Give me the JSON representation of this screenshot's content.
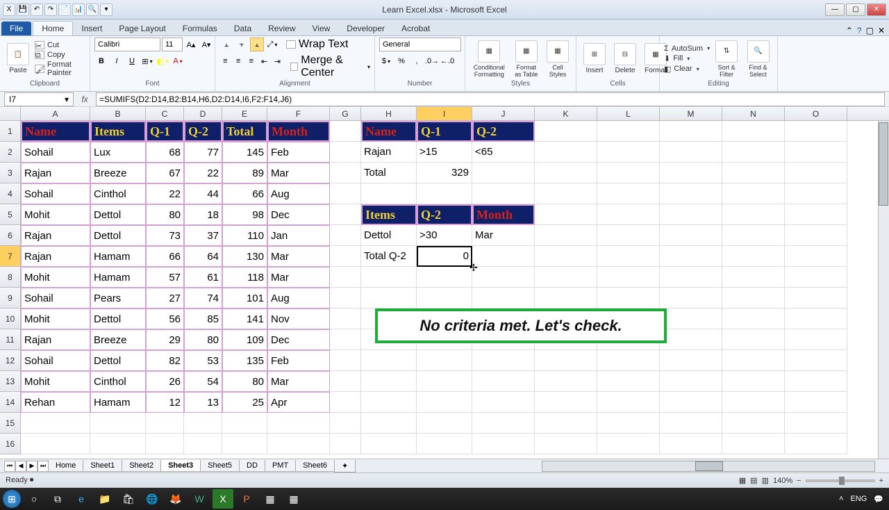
{
  "app": {
    "title": "Learn Excel.xlsx - Microsoft Excel"
  },
  "tabs": {
    "file": "File",
    "home": "Home",
    "insert": "Insert",
    "pagelayout": "Page Layout",
    "formulas": "Formulas",
    "data": "Data",
    "review": "Review",
    "view": "View",
    "developer": "Developer",
    "acrobat": "Acrobat"
  },
  "ribbon": {
    "clipboard": {
      "label": "Clipboard",
      "paste": "Paste",
      "cut": "Cut",
      "copy": "Copy",
      "format_painter": "Format Painter"
    },
    "font": {
      "label": "Font",
      "name": "Calibri",
      "size": "11"
    },
    "alignment": {
      "label": "Alignment",
      "wrap": "Wrap Text",
      "merge": "Merge & Center"
    },
    "number": {
      "label": "Number",
      "format": "General"
    },
    "styles": {
      "label": "Styles",
      "cond": "Conditional Formatting",
      "table": "Format as Table",
      "cell": "Cell Styles"
    },
    "cells": {
      "label": "Cells",
      "insert": "Insert",
      "delete": "Delete",
      "format": "Format"
    },
    "editing": {
      "label": "Editing",
      "autosum": "AutoSum",
      "fill": "Fill",
      "clear": "Clear",
      "sort": "Sort & Filter",
      "find": "Find & Select"
    }
  },
  "namebox": "I7",
  "formula": "=SUMIFS(D2:D14,B2:B14,H6,D2:D14,I6,F2:F14,J6)",
  "cols": [
    "A",
    "B",
    "C",
    "D",
    "E",
    "F",
    "G",
    "H",
    "I",
    "J",
    "K",
    "L",
    "M",
    "N",
    "O"
  ],
  "rows": [
    "1",
    "2",
    "3",
    "4",
    "5",
    "6",
    "7",
    "8",
    "9",
    "10",
    "11",
    "12",
    "13",
    "14",
    "15",
    "16"
  ],
  "headers_main": {
    "name": "Name",
    "items": "Items",
    "q1": "Q-1",
    "q2": "Q-2",
    "total": "Total",
    "month": "Month"
  },
  "table": [
    {
      "name": "Sohail",
      "items": "Lux",
      "q1": "68",
      "q2": "77",
      "total": "145",
      "month": "Feb"
    },
    {
      "name": "Rajan",
      "items": "Breeze",
      "q1": "67",
      "q2": "22",
      "total": "89",
      "month": "Mar"
    },
    {
      "name": "Sohail",
      "items": "Cinthol",
      "q1": "22",
      "q2": "44",
      "total": "66",
      "month": "Aug"
    },
    {
      "name": "Mohit",
      "items": "Dettol",
      "q1": "80",
      "q2": "18",
      "total": "98",
      "month": "Dec"
    },
    {
      "name": "Rajan",
      "items": "Dettol",
      "q1": "73",
      "q2": "37",
      "total": "110",
      "month": "Jan"
    },
    {
      "name": "Rajan",
      "items": "Hamam",
      "q1": "66",
      "q2": "64",
      "total": "130",
      "month": "Mar"
    },
    {
      "name": "Mohit",
      "items": "Hamam",
      "q1": "57",
      "q2": "61",
      "total": "118",
      "month": "Mar"
    },
    {
      "name": "Sohail",
      "items": "Pears",
      "q1": "27",
      "q2": "74",
      "total": "101",
      "month": "Aug"
    },
    {
      "name": "Mohit",
      "items": "Dettol",
      "q1": "56",
      "q2": "85",
      "total": "141",
      "month": "Nov"
    },
    {
      "name": "Rajan",
      "items": "Breeze",
      "q1": "29",
      "q2": "80",
      "total": "109",
      "month": "Dec"
    },
    {
      "name": "Sohail",
      "items": "Dettol",
      "q1": "82",
      "q2": "53",
      "total": "135",
      "month": "Feb"
    },
    {
      "name": "Mohit",
      "items": "Cinthol",
      "q1": "26",
      "q2": "54",
      "total": "80",
      "month": "Mar"
    },
    {
      "name": "Rehan",
      "items": "Hamam",
      "q1": "12",
      "q2": "13",
      "total": "25",
      "month": "Apr"
    }
  ],
  "crit1": {
    "hdr_name": "Name",
    "hdr_q1": "Q-1",
    "hdr_q2": "Q-2",
    "name": "Rajan",
    "q1": ">15",
    "q2": "<65",
    "total_lbl": "Total",
    "total_val": "329"
  },
  "crit2": {
    "hdr_items": "Items",
    "hdr_q2": "Q-2",
    "hdr_month": "Month",
    "items": "Dettol",
    "q2": ">30",
    "month": "Mar",
    "total_lbl": "Total Q-2",
    "total_val": "0"
  },
  "callout": "No criteria met. Let's check.",
  "sheets": {
    "home": "Home",
    "s1": "Sheet1",
    "s2": "Sheet2",
    "s3": "Sheet3",
    "s5": "Sheet5",
    "dd": "DD",
    "pmt": "PMT",
    "s6": "Sheet6"
  },
  "status": {
    "ready": "Ready",
    "zoom": "140%",
    "lang": "ENG",
    "time": ""
  }
}
